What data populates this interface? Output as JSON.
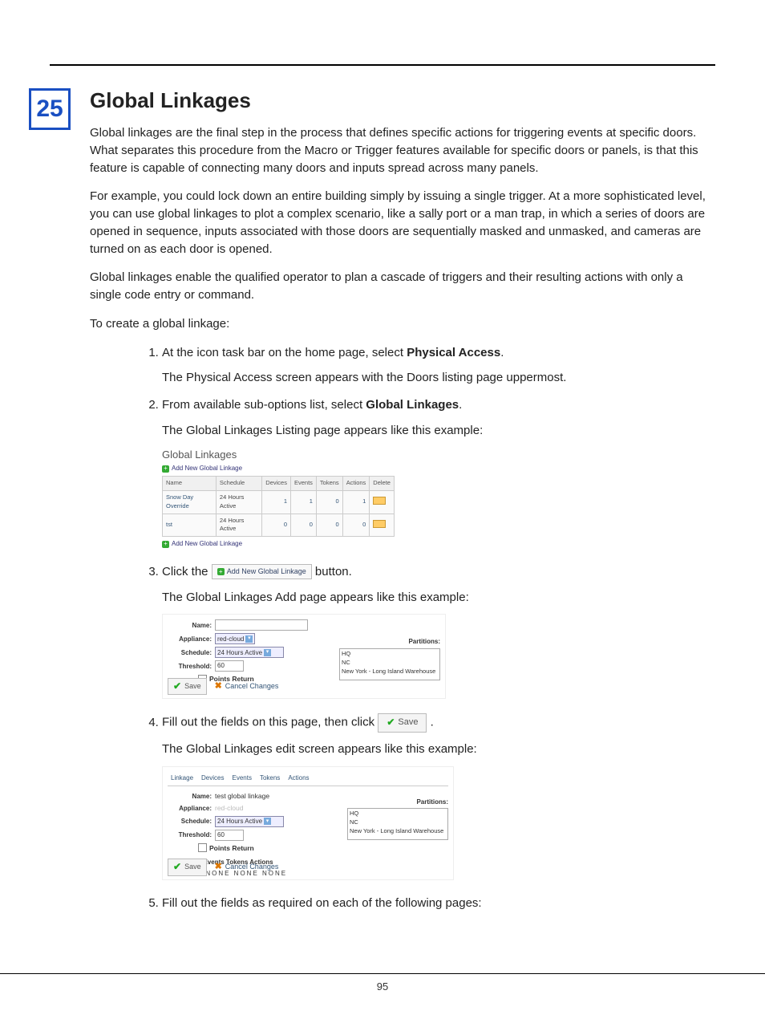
{
  "chapter_number": "25",
  "page_number": "95",
  "heading": "Global Linkages",
  "para1": "Global linkages are the final step in the process that defines specific actions for triggering events at specific doors. What separates this procedure from the Macro or Trigger features available for specific doors or panels, is that this feature is capable of connecting many doors and inputs spread across many panels.",
  "para2": "For example, you could lock down an entire building simply by issuing a single trigger. At a more sophisticated level, you can use global linkages to plot a complex scenario, like a sally port or a man trap, in which a series of doors are opened in sequence, inputs associated with those doors are sequentially masked and unmasked, and cameras are turned on as each door is opened.",
  "para3": "Global linkages enable the qualified operator to plan a cascade of triggers and their resulting actions with only a single code entry or command.",
  "para4": "To create a global linkage:",
  "steps": {
    "s1a": "At the icon task bar on the home page, select ",
    "s1b": "Physical Access",
    "s1c": ".",
    "s1sub": "The Physical Access screen appears with the Doors listing page uppermost.",
    "s2a": "From available sub-options list, select ",
    "s2b": "Global Linkages",
    "s2c": ".",
    "s2sub": "The Global Linkages Listing page appears like this example:",
    "s3a": "Click the ",
    "s3b": " button.",
    "s3sub": "The Global Linkages Add page appears like this example:",
    "s4a": "Fill out the fields on this page, then click ",
    "s4b": ".",
    "s4sub": "The Global Linkages edit screen appears like this example:",
    "s5": "Fill out the fields as required on each of the following pages:"
  },
  "fig1": {
    "title": "Global Linkages",
    "add_link": "Add New Global Linkage",
    "cols": [
      "Name",
      "Schedule",
      "Devices",
      "Events",
      "Tokens",
      "Actions",
      "Delete"
    ],
    "rows": [
      {
        "name": "Snow Day Override",
        "sched": "24 Hours Active",
        "d": "1",
        "e": "1",
        "t": "0",
        "a": "1"
      },
      {
        "name": "tst",
        "sched": "24 Hours Active",
        "d": "0",
        "e": "0",
        "t": "0",
        "a": "0"
      }
    ]
  },
  "inline_add_btn": "Add New Global Linkage",
  "save_btn": "Save",
  "fig2": {
    "labels": {
      "name": "Name:",
      "appliance": "Appliance:",
      "schedule": "Schedule:",
      "threshold": "Threshold:",
      "points": "Points Return",
      "partitions": "Partitions:"
    },
    "appliance": "red-cloud",
    "schedule": "24 Hours Active",
    "threshold": "60",
    "partitions": [
      "HQ",
      "NC",
      "New York - Long Island Warehouse"
    ],
    "cancel": "Cancel Changes"
  },
  "fig3": {
    "tabs": [
      "Linkage",
      "Devices",
      "Events",
      "Tokens",
      "Actions"
    ],
    "name_val": "test global linkage",
    "appliance": "red-cloud",
    "schedule": "24 Hours Active",
    "threshold": "60",
    "sect_head": "Devices Events Tokens Actions",
    "sect_vals": "NONE   NONE   NONE   NONE",
    "partitions": [
      "HQ",
      "NC",
      "New York - Long Island Warehouse"
    ],
    "cancel": "Cancel Changes"
  }
}
